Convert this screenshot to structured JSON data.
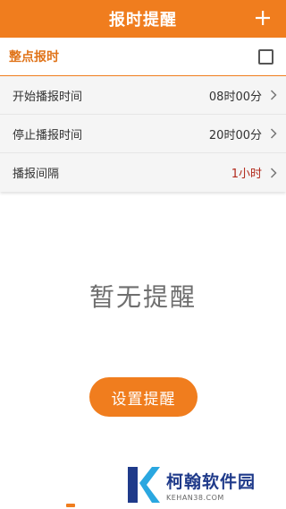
{
  "header": {
    "title": "报时提醒",
    "add_icon": "plus-icon"
  },
  "hourly": {
    "label": "整点报时",
    "checked": false
  },
  "settings": [
    {
      "label": "开始播报时间",
      "value": "08时00分"
    },
    {
      "label": "停止播报时间",
      "value": "20时00分"
    },
    {
      "label": "播报间隔",
      "value": "1小时"
    }
  ],
  "empty_state": {
    "text": "暂无提醒",
    "button_label": "设置提醒"
  },
  "watermark": {
    "name": "柯翰软件园",
    "domain": "KEHAN38.COM"
  },
  "colors": {
    "accent": "#f07d1e",
    "interval_value": "#b22a1c",
    "watermark": "#1f3a8a"
  }
}
